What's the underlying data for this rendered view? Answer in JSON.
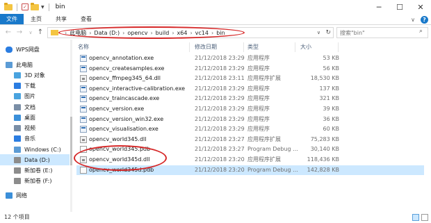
{
  "window": {
    "title": "bin"
  },
  "ribbon": {
    "tabs": [
      "文件",
      "主页",
      "共享",
      "查看"
    ]
  },
  "address": {
    "crumbs": [
      "此电脑",
      "Data (D:)",
      "opencv",
      "build",
      "x64",
      "vc14",
      "bin"
    ]
  },
  "search": {
    "placeholder": "搜索\"bin\""
  },
  "nav": [
    {
      "label": "WPS网盘",
      "color": "#2b7de1"
    },
    {
      "label": "此电脑",
      "color": "#5b9bd5"
    },
    {
      "label": "3D 对象",
      "color": "#4aa3df"
    },
    {
      "label": "下载",
      "color": "#2b7de1"
    },
    {
      "label": "图片",
      "color": "#4aa3df"
    },
    {
      "label": "文档",
      "color": "#7a8ea6"
    },
    {
      "label": "桌面",
      "color": "#3b8fd9"
    },
    {
      "label": "视频",
      "color": "#7a8ea6"
    },
    {
      "label": "音乐",
      "color": "#2b7de1"
    },
    {
      "label": "Windows (C:)",
      "color": "#5b9bd5"
    },
    {
      "label": "Data (D:)",
      "color": "#8c8c8c"
    },
    {
      "label": "新加卷 (E:)",
      "color": "#8c8c8c"
    },
    {
      "label": "新加卷 (F:)",
      "color": "#8c8c8c"
    },
    {
      "label": "网络",
      "color": "#3b8fd9"
    }
  ],
  "columns": {
    "name": "名称",
    "date": "修改日期",
    "type": "类型",
    "size": "大小"
  },
  "files": [
    {
      "name": "opencv_annotation.exe",
      "date": "21/12/2018 23:29",
      "type": "应用程序",
      "size": "53 KB",
      "kind": "exe"
    },
    {
      "name": "opencv_createsamples.exe",
      "date": "21/12/2018 23:29",
      "type": "应用程序",
      "size": "56 KB",
      "kind": "exe"
    },
    {
      "name": "opencv_ffmpeg345_64.dll",
      "date": "21/12/2018 23:11",
      "type": "应用程序扩展",
      "size": "18,530 KB",
      "kind": "dll"
    },
    {
      "name": "opencv_interactive-calibration.exe",
      "date": "21/12/2018 23:29",
      "type": "应用程序",
      "size": "137 KB",
      "kind": "exe"
    },
    {
      "name": "opencv_traincascade.exe",
      "date": "21/12/2018 23:29",
      "type": "应用程序",
      "size": "321 KB",
      "kind": "exe"
    },
    {
      "name": "opencv_version.exe",
      "date": "21/12/2018 23:29",
      "type": "应用程序",
      "size": "39 KB",
      "kind": "exe"
    },
    {
      "name": "opencv_version_win32.exe",
      "date": "21/12/2018 23:29",
      "type": "应用程序",
      "size": "36 KB",
      "kind": "exe"
    },
    {
      "name": "opencv_visualisation.exe",
      "date": "21/12/2018 23:29",
      "type": "应用程序",
      "size": "60 KB",
      "kind": "exe"
    },
    {
      "name": "opencv_world345.dll",
      "date": "21/12/2018 23:27",
      "type": "应用程序扩展",
      "size": "75,283 KB",
      "kind": "dll"
    },
    {
      "name": "opencv_world345.pdb",
      "date": "21/12/2018 23:27",
      "type": "Program Debug ...",
      "size": "30,140 KB",
      "kind": "pdb"
    },
    {
      "name": "opencv_world345d.dll",
      "date": "21/12/2018 23:20",
      "type": "应用程序扩展",
      "size": "118,436 KB",
      "kind": "dll"
    },
    {
      "name": "opencv_world345d.pdb",
      "date": "21/12/2018 23:20",
      "type": "Program Debug ...",
      "size": "142,828 KB",
      "kind": "pdb"
    }
  ],
  "status": {
    "count": "12 个项目"
  }
}
